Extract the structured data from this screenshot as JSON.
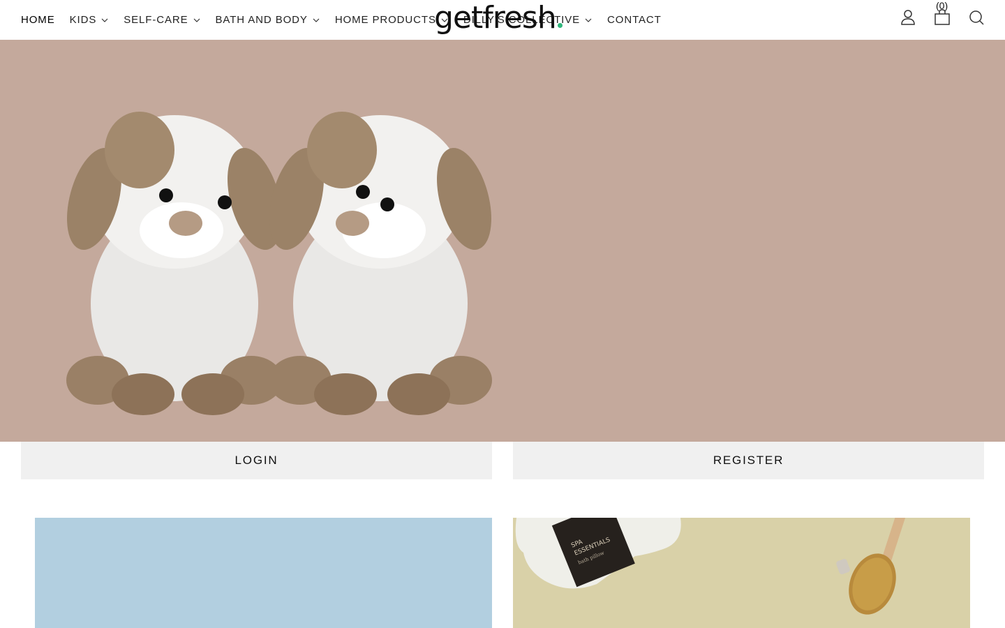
{
  "nav": {
    "items": [
      {
        "label": "HOME",
        "dropdown": false
      },
      {
        "label": "KIDS",
        "dropdown": true
      },
      {
        "label": "SELF-CARE",
        "dropdown": true
      },
      {
        "label": "BATH AND BODY",
        "dropdown": true
      },
      {
        "label": "HOME PRODUCTS",
        "dropdown": true
      },
      {
        "label": "DILLY'S COLLECTIVE",
        "dropdown": true
      },
      {
        "label": "CONTACT",
        "dropdown": false
      }
    ]
  },
  "logo": {
    "text": "getfresh",
    "dot_color": "#2fb67c"
  },
  "header_icons": {
    "account": "user-icon",
    "cart": "bag-icon",
    "cart_count": "(0)",
    "search": "search-icon"
  },
  "hero": {
    "background": "#c4a99c"
  },
  "auth": {
    "login_label": "LOGIN",
    "register_label": "REGISTER"
  },
  "tiles": {
    "left_color": "#b2cfe0",
    "right_color": "#d9d1a8",
    "pillow_text_1": "SPA",
    "pillow_text_2": "ESSENTIALS",
    "pillow_text_3": "bath pillow"
  }
}
